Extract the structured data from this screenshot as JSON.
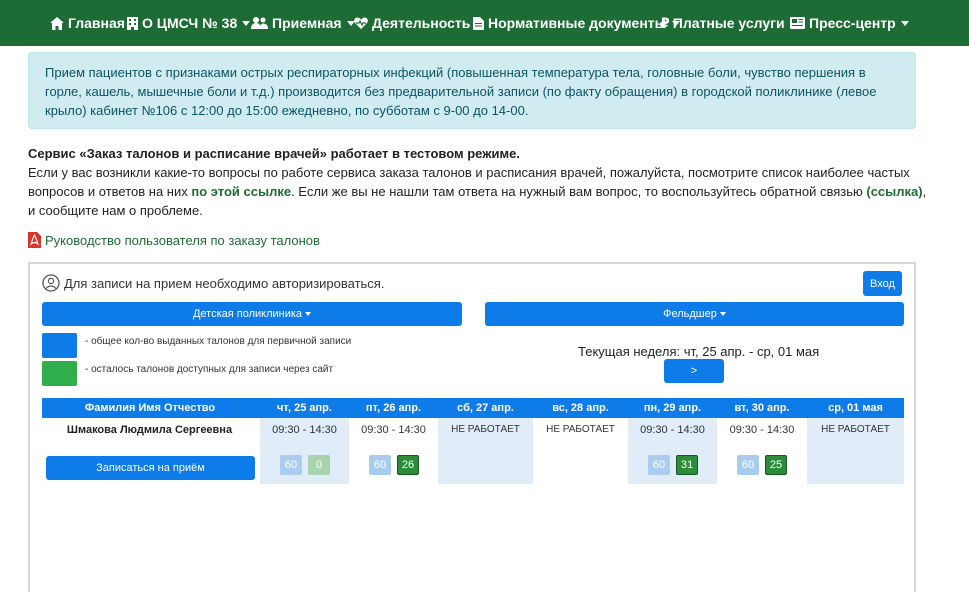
{
  "nav": {
    "home": "Главная",
    "about": "О ЦМСЧ № 38",
    "reception": "Приемная",
    "activity": "Деятельность",
    "docs": "Нормативные документы",
    "paid": "Платные услуги",
    "press": "Пресс-центр"
  },
  "alert": {
    "text": "Прием пациентов с признаками острых респираторных инфекций (повышенная температура тела, головные боли, чувство першения в горле, кашель, мышечные боли и т.д.) производится без предварительной записи (по факту обращения) в городской поликлинике (левое крыло) кабинет №106 с 12:00 до 15:00 ежедневно, по субботам с 9-00 до 14-00."
  },
  "notice": {
    "title": "Сервис «Заказ талонов и расписание врачей» работает в тестовом режиме.",
    "part1": "Если у вас возникли какие-то вопросы по работе сервиса заказа талонов и расписания врачей, пожалуйста, посмотрите список наиболее частых вопросов и ответов на них ",
    "link1": "по этой ссылке",
    "part2": ". Если же вы не нашли там ответа на нужный вам вопрос, то воспользуйтесь обратной связью ",
    "link2": "(ссылка)",
    "part3": ", и сообщите нам о проблеме."
  },
  "guide_link": "Руководство пользователя по заказу талонов",
  "panel": {
    "auth_text": "Для записи на прием необходимо авторизироваться.",
    "login_button": "Вход",
    "clinic_dropdown": "Детская поликлиника",
    "specialty_dropdown": "Фельдшер",
    "legend_total": "- общее кол-во выданных талонов для первичной записи",
    "legend_free": "- осталось талонов доступных для записи через сайт",
    "week_label": "Текущая неделя: чт, 25 апр. - ср, 01 мая",
    "next_button": ">",
    "colors": {
      "accent": "#0d7be8",
      "nav": "#1d6b35",
      "free": "#2c8c3a",
      "total": "#a9cdf0"
    }
  },
  "table": {
    "headers": [
      "Фамилия Имя Отчество",
      "чт, 25 апр.",
      "пт, 26 апр.",
      "сб, 27 апр.",
      "вс, 28 апр.",
      "пн, 29 апр.",
      "вт, 30 апр.",
      "ср, 01 мая"
    ],
    "doctor": "Шмакова Людмила Сергеевна",
    "book_button": "Записаться на приём",
    "days": [
      {
        "time": "09:30 - 14:30",
        "total": "60",
        "free": "0"
      },
      {
        "time": "09:30 - 14:30",
        "total": "60",
        "free": "26"
      },
      {
        "closed": "НЕ РАБОТАЕТ"
      },
      {
        "closed": "НЕ РАБОТАЕТ"
      },
      {
        "time": "09:30 - 14:30",
        "total": "60",
        "free": "31"
      },
      {
        "time": "09:30 - 14:30",
        "total": "60",
        "free": "25"
      },
      {
        "closed": "НЕ РАБОТАЕТ"
      }
    ]
  }
}
